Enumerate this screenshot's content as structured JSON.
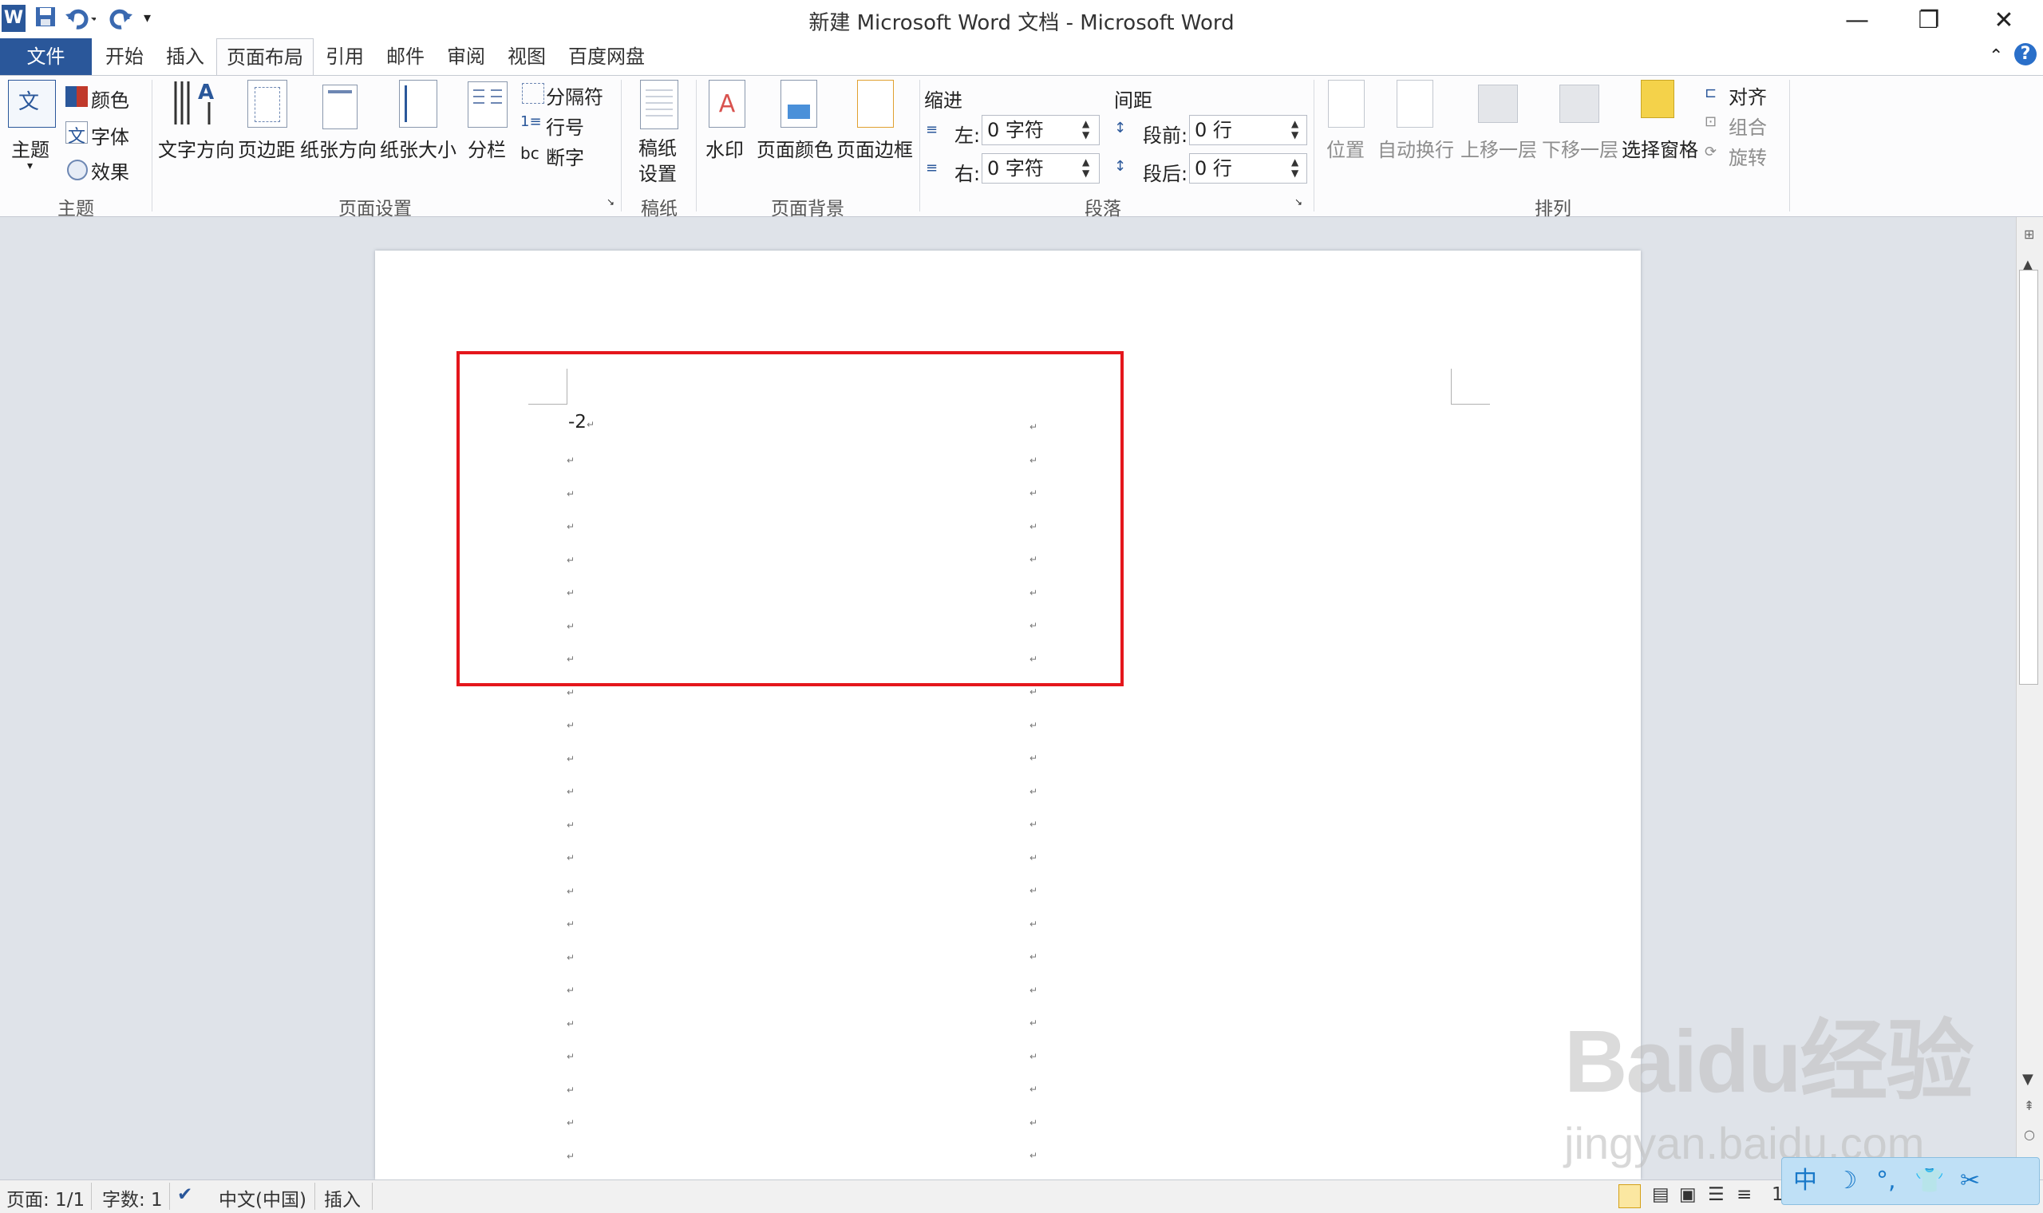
{
  "window": {
    "title": "新建 Microsoft Word 文档 - Microsoft Word"
  },
  "tabs": {
    "file": "文件",
    "home": "开始",
    "insert": "插入",
    "page_layout": "页面布局",
    "references": "引用",
    "mailings": "邮件",
    "review": "审阅",
    "view": "视图",
    "baidu": "百度网盘"
  },
  "ribbon": {
    "theme": {
      "themes": "主题",
      "colors": "颜色",
      "fonts": "字体",
      "effects": "效果",
      "group": "主题"
    },
    "page_setup": {
      "text_direction": "文字方向",
      "margins": "页边距",
      "orientation": "纸张方向",
      "size": "纸张大小",
      "columns": "分栏",
      "breaks": "分隔符",
      "line_numbers": "行号",
      "hyphenation": "断字",
      "group": "页面设置"
    },
    "draft": {
      "label_1": "稿纸",
      "label_2": "设置",
      "group": "稿纸"
    },
    "background": {
      "watermark": "水印",
      "page_color": "页面颜色",
      "page_borders": "页面边框",
      "group": "页面背景"
    },
    "paragraph": {
      "indent_title": "缩进",
      "left": "左:",
      "right": "右:",
      "indent_left_value": "0 字符",
      "indent_right_value": "0 字符",
      "spacing_title": "间距",
      "before": "段前:",
      "after": "段后:",
      "before_value": "0 行",
      "after_value": "0 行",
      "group": "段落"
    },
    "arrange": {
      "position": "位置",
      "wrap": "自动换行",
      "forward": "上移一层",
      "backward": "下移一层",
      "selection_pane": "选择窗格",
      "align": "对齐",
      "group_btn": "组合",
      "rotate": "旋转",
      "group": "排列"
    }
  },
  "document": {
    "first_line": "-2"
  },
  "status": {
    "page": "页面: 1/1",
    "words": "字数: 1",
    "language": "中文(中国)",
    "mode": "插入",
    "zoom_partial": "1"
  },
  "watermark": {
    "logo": "Baidu经验",
    "url": "jingyan.baidu.com"
  },
  "ime": {
    "label": "中"
  },
  "colors": {
    "file_tab": "#2a579a",
    "highlight_box": "#e4161c",
    "workspace": "#dfe3e9"
  }
}
